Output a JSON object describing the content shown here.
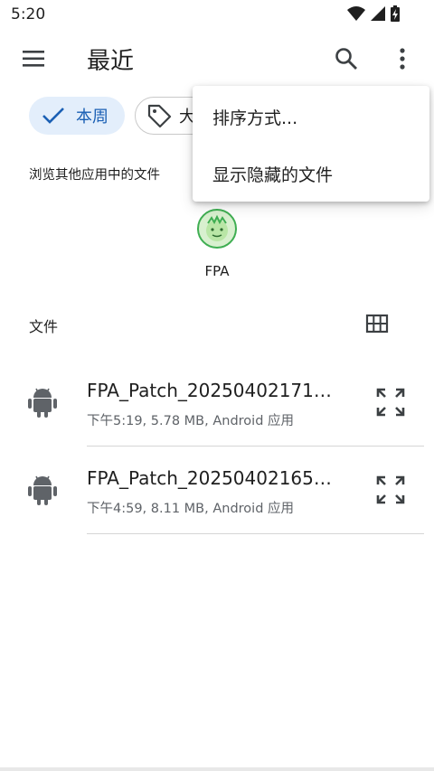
{
  "status_bar": {
    "time": "5:20"
  },
  "app_bar": {
    "title": "最近"
  },
  "chips": {
    "week": "本周",
    "large": "大"
  },
  "browse": {
    "heading": "浏览其他应用中的文件",
    "apps": [
      {
        "label": "FPA"
      }
    ]
  },
  "files": {
    "heading": "文件",
    "items": [
      {
        "name": "FPA_Patch_20250402171…",
        "meta": "下午5:19, 5.78 MB, Android 应用"
      },
      {
        "name": "FPA_Patch_20250402165…",
        "meta": "下午4:59, 8.11 MB, Android 应用"
      }
    ]
  },
  "menu": {
    "items": [
      "排序方式...",
      "显示隐藏的文件"
    ]
  },
  "colors": {
    "accent": "#1a5fb4",
    "chip_selected_bg": "#e3eefb",
    "icon_gray": "#5f6368"
  }
}
